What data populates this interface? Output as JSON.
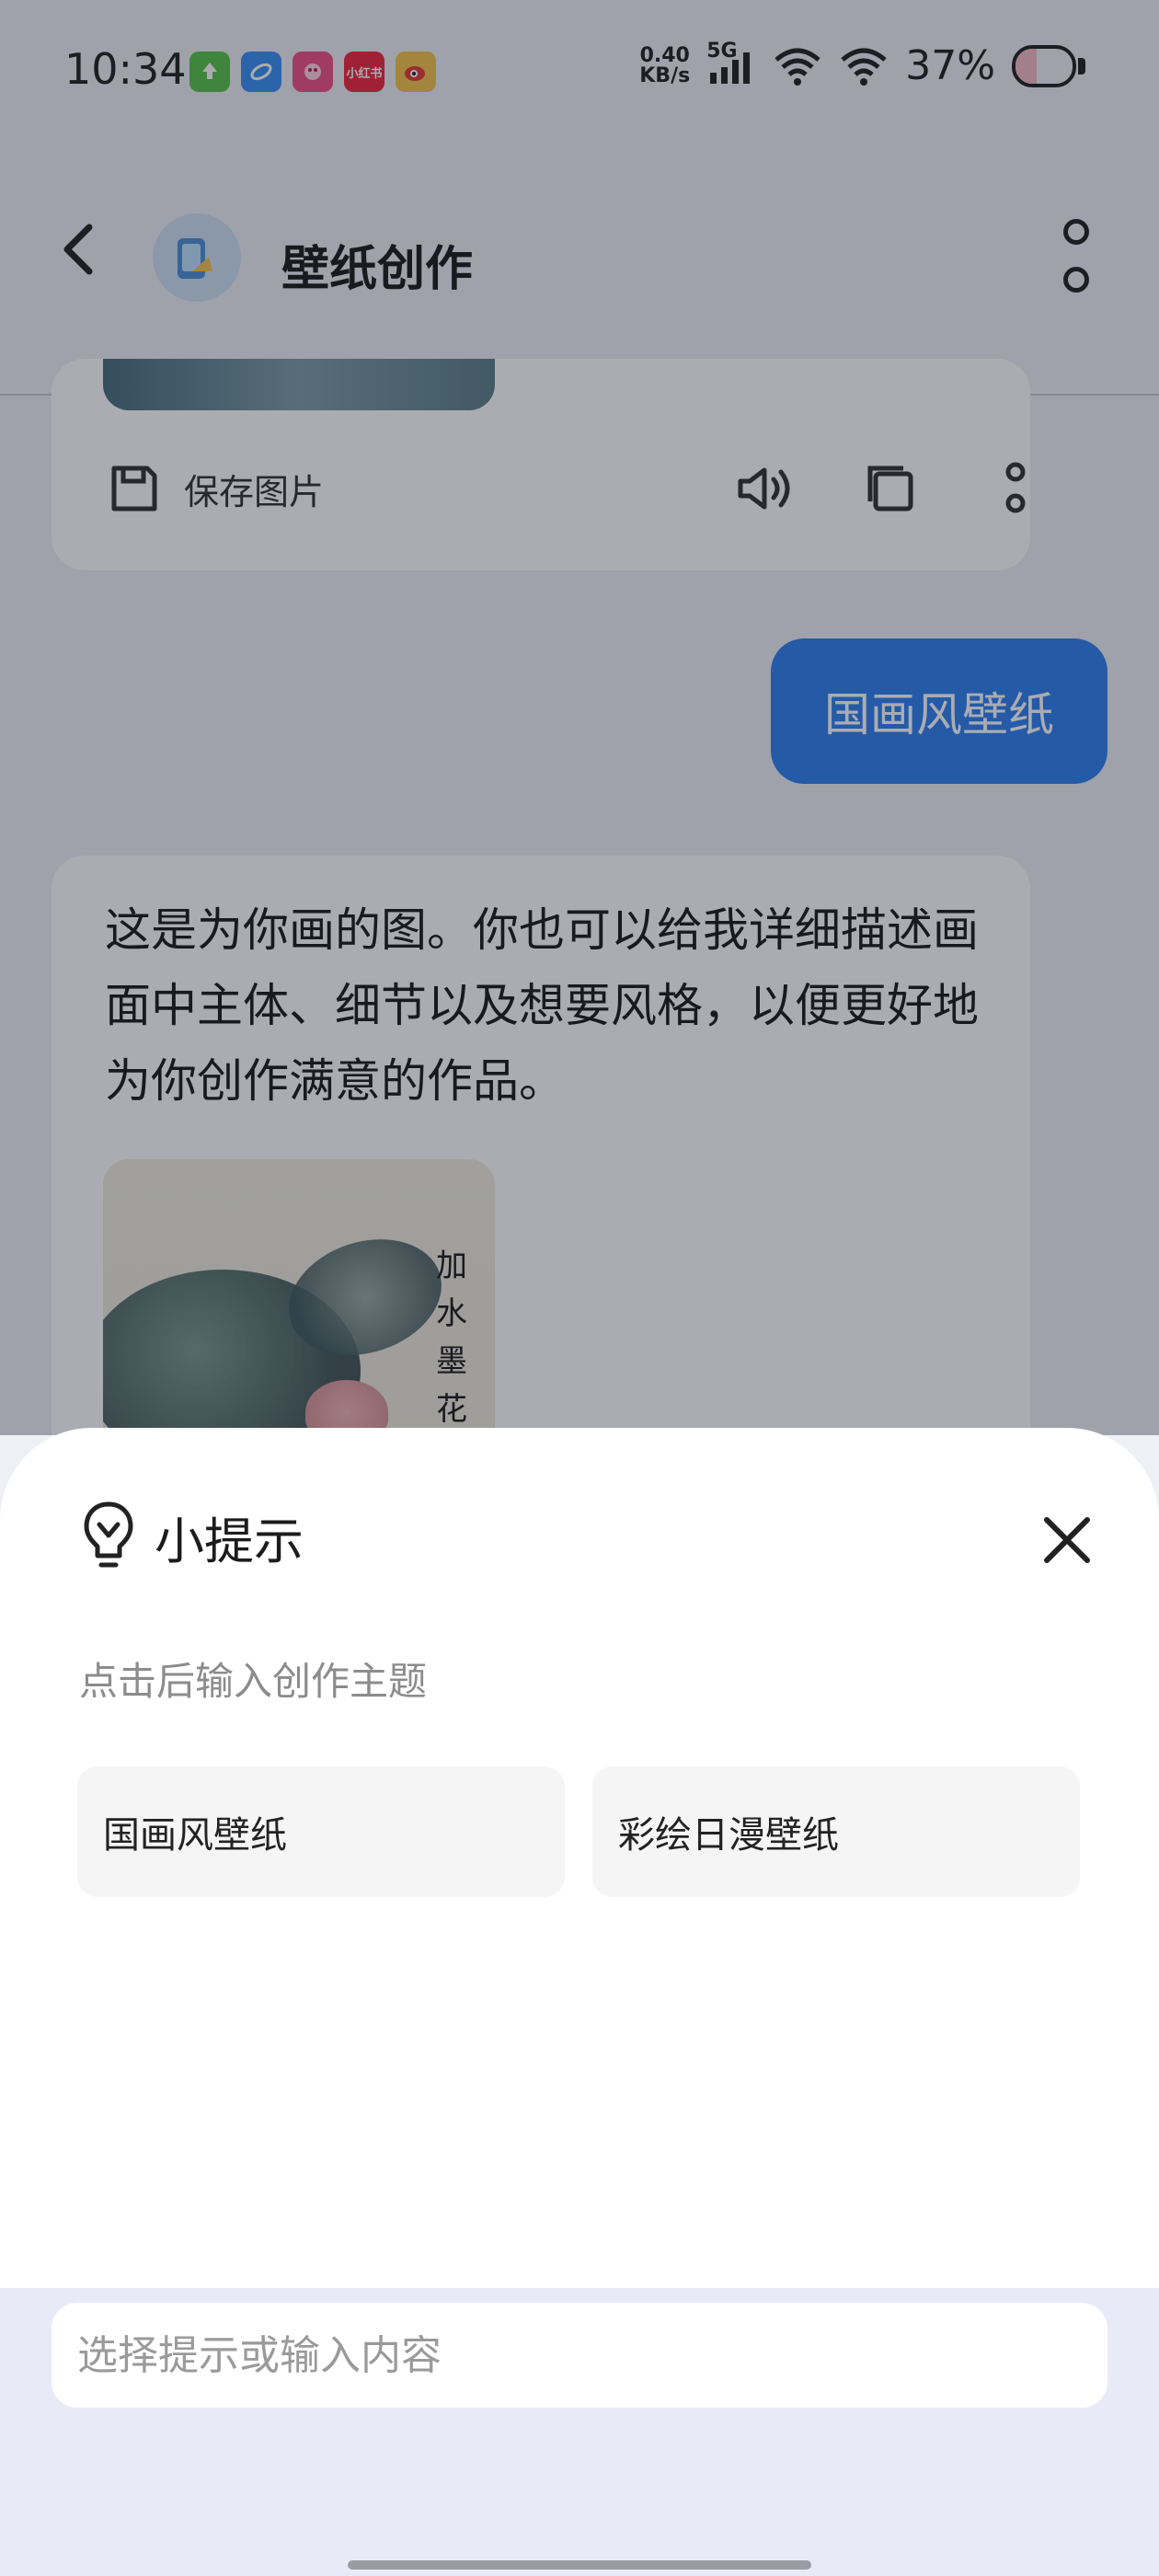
{
  "status_bar": {
    "time": "10:34",
    "net_speed_value": "0.40",
    "net_speed_unit": "KB/s",
    "network_type": "5G",
    "battery_percent": "37%",
    "battery_level": 0.37,
    "app_icons": [
      "upload-app-icon",
      "browser-app-icon",
      "shopping-app-icon",
      "xiaohongshu-app-icon",
      "weibo-app-icon"
    ],
    "xiaohongshu_label": "小红书"
  },
  "header": {
    "title": "壁纸创作",
    "back_icon": "chevron-left-icon",
    "more_icon": "more-vertical-icon"
  },
  "messages": {
    "first_ai": {
      "save_label": "保存图片",
      "actions": [
        "speaker-icon",
        "copy-icon",
        "more-icon"
      ]
    },
    "user": {
      "text": "国画风壁纸"
    },
    "second_ai": {
      "text": "这是为你画的图。你也可以给我详细描述画面中主体、细节以及想要风格，以便更好地为你创作满意的作品。",
      "calligraphy": "加水墨花清"
    }
  },
  "sheet": {
    "title": "小提示",
    "hint": "点击后输入创作主题",
    "chips": [
      "国画风壁纸",
      "彩绘日漫壁纸"
    ],
    "close_icon": "close-icon",
    "title_icon": "lightbulb-icon"
  },
  "input": {
    "placeholder": "选择提示或输入内容",
    "value": ""
  },
  "colors": {
    "user_bubble": "#2f7ff0",
    "input_bg": "#e8ebf7"
  }
}
